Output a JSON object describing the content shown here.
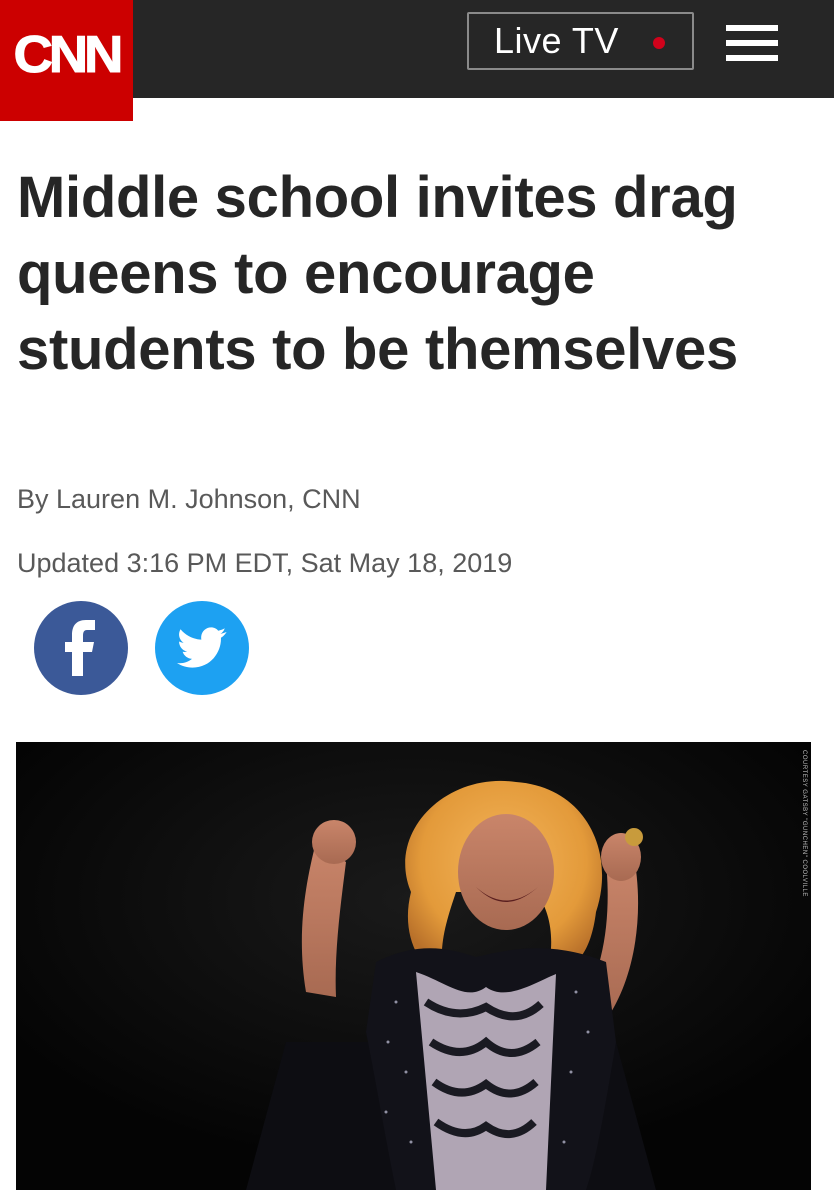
{
  "header": {
    "logo_text": "CNN",
    "live_tv_label": "Live TV",
    "live_dot_color": "#d0021b",
    "menu_icon": "hamburger-menu-icon"
  },
  "article": {
    "headline": "Middle school invites drag queens to encourage students to be themselves",
    "byline": "By Lauren M. Johnson, CNN",
    "updated": "Updated 3:16 PM EDT, Sat May 18, 2019"
  },
  "share": {
    "facebook_icon": "facebook-icon",
    "twitter_icon": "twitter-icon",
    "facebook_color": "#3b5998",
    "twitter_color": "#1da1f2"
  },
  "hero_image": {
    "credit": "COURTESY GATSBY \"GUNCHEN\" COOLVILLE"
  },
  "colors": {
    "brand_red": "#cc0000",
    "header_bg": "#262626"
  }
}
